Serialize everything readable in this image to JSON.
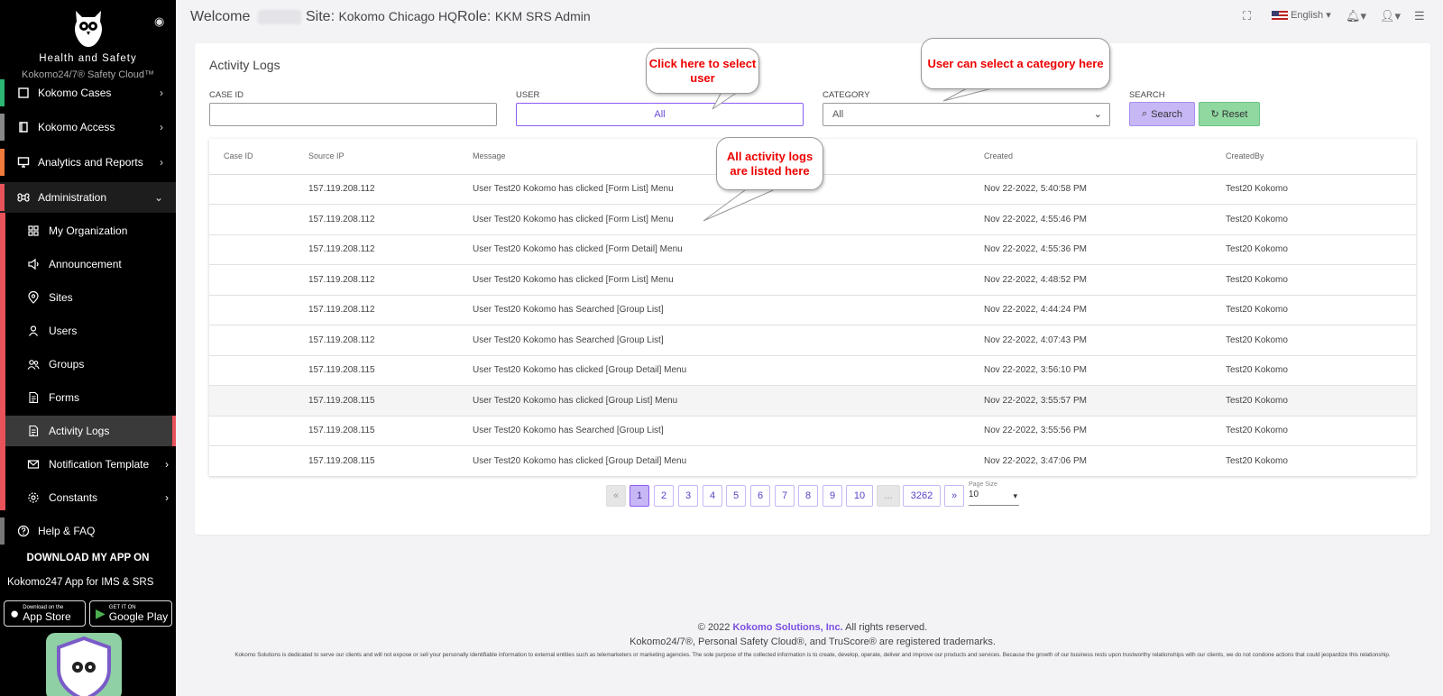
{
  "sidebar": {
    "brand_line1": "Health and Safety",
    "brand_line2": "Kokomo24/7® Safety Cloud™",
    "items": [
      {
        "label": "Kokomo Cases",
        "icon": "cases-icon"
      },
      {
        "label": "Kokomo Access",
        "icon": "book-icon"
      },
      {
        "label": "Analytics and Reports",
        "icon": "monitor-icon"
      },
      {
        "label": "Administration",
        "icon": "command-icon"
      }
    ],
    "sub_items": [
      {
        "label": "My Organization",
        "icon": "grid-icon"
      },
      {
        "label": "Announcement",
        "icon": "megaphone-icon"
      },
      {
        "label": "Sites",
        "icon": "location-pin-icon"
      },
      {
        "label": "Users",
        "icon": "user-icon"
      },
      {
        "label": "Groups",
        "icon": "users-icon"
      },
      {
        "label": "Forms",
        "icon": "document-icon"
      },
      {
        "label": "Activity Logs",
        "icon": "document-icon"
      },
      {
        "label": "Notification Template",
        "icon": "mail-icon"
      },
      {
        "label": "Constants",
        "icon": "gear-icon"
      }
    ],
    "help": "Help & FAQ",
    "download_title": "DOWNLOAD MY APP ON",
    "app_line": "Kokomo247 App for IMS & SRS",
    "app_store_small": "Download on the",
    "app_store_big": "App Store",
    "play_small": "GET IT ON",
    "play_big": "Google Play"
  },
  "topbar": {
    "welcome": "Welcome",
    "site_label": "Site:",
    "site_value": "Kokomo Chicago HQ",
    "role_label": "Role:",
    "role_value": "KKM SRS Admin",
    "language": "English"
  },
  "page": {
    "title": "Activity Logs",
    "filters": {
      "case_id_label": "CASE ID",
      "case_id_value": "",
      "user_label": "USER",
      "user_value": "All",
      "category_label": "CATEGORY",
      "category_value": "All",
      "search_label": "SEARCH",
      "search_button": "Search",
      "reset_button": "Reset"
    },
    "table": {
      "columns": [
        "Case ID",
        "Source IP",
        "Message",
        "Created",
        "CreatedBy"
      ],
      "rows": [
        {
          "case_id": "",
          "ip": "157.119.208.112",
          "message": "User Test20 Kokomo has clicked [Form List] Menu",
          "created": "Nov 22-2022, 5:40:58 PM",
          "by": "Test20 Kokomo"
        },
        {
          "case_id": "",
          "ip": "157.119.208.112",
          "message": "User Test20 Kokomo has clicked [Form List] Menu",
          "created": "Nov 22-2022, 4:55:46 PM",
          "by": "Test20 Kokomo"
        },
        {
          "case_id": "",
          "ip": "157.119.208.112",
          "message": "User Test20 Kokomo has clicked [Form Detail] Menu",
          "created": "Nov 22-2022, 4:55:36 PM",
          "by": "Test20 Kokomo"
        },
        {
          "case_id": "",
          "ip": "157.119.208.112",
          "message": "User Test20 Kokomo has clicked [Form List] Menu",
          "created": "Nov 22-2022, 4:48:52 PM",
          "by": "Test20 Kokomo"
        },
        {
          "case_id": "",
          "ip": "157.119.208.112",
          "message": "User Test20 Kokomo has Searched [Group List]",
          "created": "Nov 22-2022, 4:44:24 PM",
          "by": "Test20 Kokomo"
        },
        {
          "case_id": "",
          "ip": "157.119.208.112",
          "message": "User Test20 Kokomo has Searched [Group List]",
          "created": "Nov 22-2022, 4:07:43 PM",
          "by": "Test20 Kokomo"
        },
        {
          "case_id": "",
          "ip": "157.119.208.115",
          "message": "User Test20 Kokomo has clicked [Group Detail] Menu",
          "created": "Nov 22-2022, 3:56:10 PM",
          "by": "Test20 Kokomo"
        },
        {
          "case_id": "",
          "ip": "157.119.208.115",
          "message": "User Test20 Kokomo has clicked [Group List] Menu",
          "created": "Nov 22-2022, 3:55:57 PM",
          "by": "Test20 Kokomo"
        },
        {
          "case_id": "",
          "ip": "157.119.208.115",
          "message": "User Test20 Kokomo has Searched [Group List]",
          "created": "Nov 22-2022, 3:55:56 PM",
          "by": "Test20 Kokomo"
        },
        {
          "case_id": "",
          "ip": "157.119.208.115",
          "message": "User Test20 Kokomo has clicked [Group Detail] Menu",
          "created": "Nov 22-2022, 3:47:06 PM",
          "by": "Test20 Kokomo"
        }
      ]
    },
    "pagination": {
      "prev": "«",
      "pages": [
        "1",
        "2",
        "3",
        "4",
        "5",
        "6",
        "7",
        "8",
        "9",
        "10"
      ],
      "ellipsis": "...",
      "last": "3262",
      "next": "»",
      "current": "1",
      "page_size_label": "Page Size",
      "page_size_value": "10"
    }
  },
  "callouts": {
    "user": "Click here to select user",
    "category": "User can select a category here",
    "logs": "All activity logs are listed here"
  },
  "footer": {
    "copyright_prefix": "© 2022",
    "company": "Kokomo Solutions, Inc.",
    "copyright_suffix": "All rights reserved.",
    "trademarks": "Kokomo24/7®, Personal Safety Cloud®, and TruScore® are registered trademarks.",
    "disclaimer": "Kokomo Solutions is dedicated to serve our clients and will not expose or sell your personally identifiable information to external entities such as telemarketers or marketing agencies. The sole purpose of the collected information is to create, develop, operate, deliver and improve our products and services. Because the growth of our business rests upon trustworthy relationships with our clients, we do not condone actions that could jeopardize this relationship."
  },
  "colors": {
    "accent": "#8a5cf5",
    "callout_text": "#e00000",
    "sidebar_bg": "#000000",
    "sidebar_rail": "#e8525a",
    "reset_green": "#8fd8a0"
  }
}
